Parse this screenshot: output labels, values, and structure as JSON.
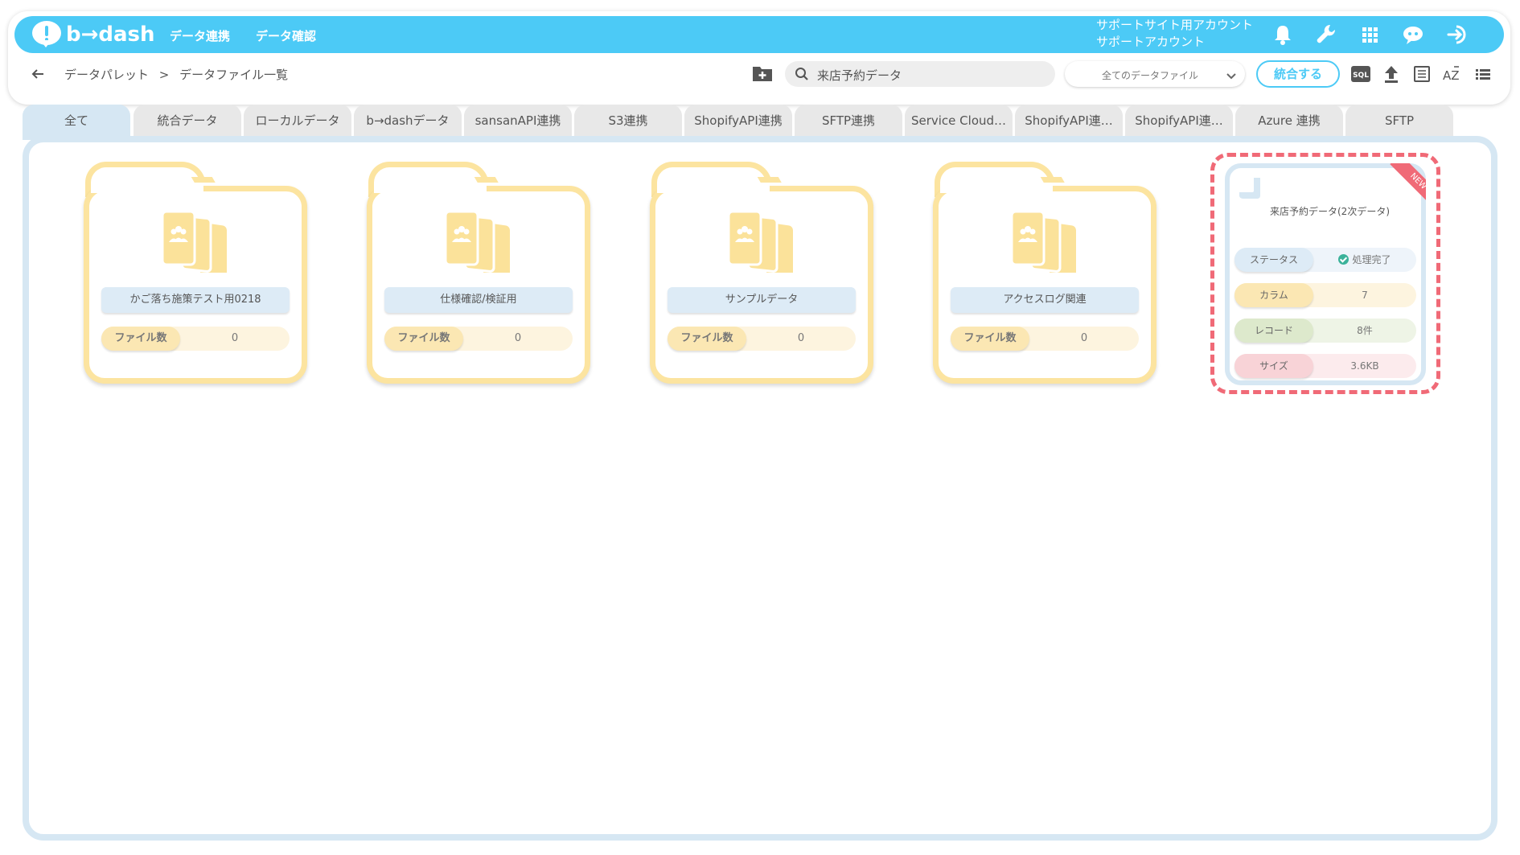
{
  "app": {
    "logo_text": "b→dash"
  },
  "nav": [
    {
      "label": "データ連携"
    },
    {
      "label": "データ確認"
    }
  ],
  "account": {
    "line1": "サポートサイト用アカウント",
    "line2": "サポートアカウント"
  },
  "topbar_icons": [
    "bell-icon",
    "wrench-icon",
    "grid-icon",
    "chatbot-icon",
    "logout-icon"
  ],
  "breadcrumb": {
    "items": [
      "データパレット",
      ">",
      "データファイル一覧"
    ]
  },
  "search": {
    "value": "来店予約データ"
  },
  "filter": {
    "selected": "全てのデータファイル"
  },
  "toolbar": {
    "merge_label": "統合する",
    "icons": [
      "sql-icon",
      "upload-icon",
      "list-view-icon",
      "sort-az-icon",
      "menu-list-icon"
    ]
  },
  "tabs": [
    {
      "label": "全て"
    },
    {
      "label": "統合データ"
    },
    {
      "label": "ローカルデータ"
    },
    {
      "label": "b→dashデータ"
    },
    {
      "label": "sansanAPI連携"
    },
    {
      "label": "S3連携"
    },
    {
      "label": "ShopifyAPI連携"
    },
    {
      "label": "SFTP連携"
    },
    {
      "label": "Service Cloud…"
    },
    {
      "label": "ShopifyAPI連…"
    },
    {
      "label": "ShopifyAPI連…"
    },
    {
      "label": "Azure 連携"
    },
    {
      "label": "SFTP"
    }
  ],
  "folders": [
    {
      "name": "かご落ち施策テスト用0218",
      "count_label": "ファイル数",
      "count": "0"
    },
    {
      "name": "仕様確認/検証用",
      "count_label": "ファイル数",
      "count": "0"
    },
    {
      "name": "サンプルデータ",
      "count_label": "ファイル数",
      "count": "0"
    },
    {
      "name": "アクセスログ関連",
      "count_label": "ファイル数",
      "count": "0"
    }
  ],
  "datafile": {
    "badge": "NEW",
    "title": "来店予約データ(2次データ)",
    "rows": [
      {
        "label": "ステータス",
        "value": "処理完了"
      },
      {
        "label": "カラム",
        "value": "7"
      },
      {
        "label": "レコード",
        "value": "8件"
      },
      {
        "label": "サイズ",
        "value": "3.6KB"
      }
    ]
  },
  "colors": {
    "topbar": "#4ccaf6",
    "folder_border": "#fce4a0",
    "panel_border": "#d6e7f3",
    "highlight_dash": "#f06a77",
    "status_ok": "#3bb29a"
  }
}
